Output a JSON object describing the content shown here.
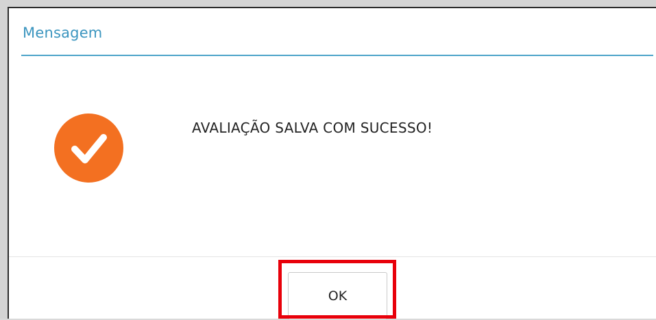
{
  "dialog": {
    "title": "Mensagem",
    "message": "AVALIAÇÃO SALVA COM SUCESSO!",
    "icon": "check-circle-icon",
    "icon_color": "#f37021",
    "ok_label": "OK"
  },
  "colors": {
    "title": "#3b95bf",
    "header_rule": "#4aa3c8",
    "highlight": "#e8000a"
  }
}
